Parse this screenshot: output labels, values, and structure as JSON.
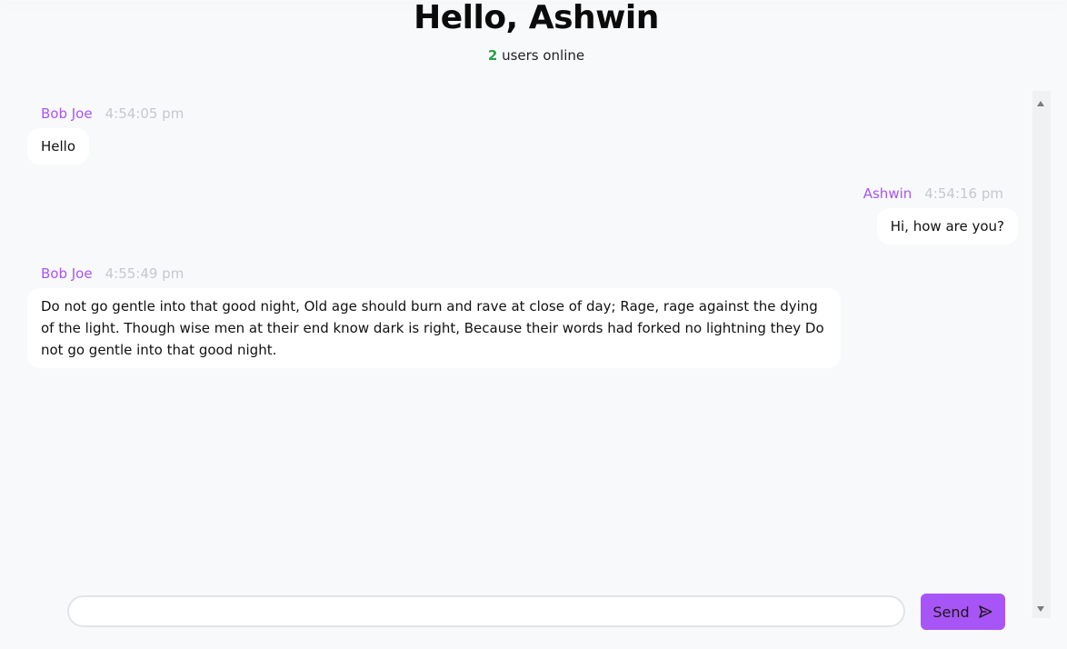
{
  "header": {
    "greeting": "Hello, Ashwin",
    "online_count": "2",
    "online_suffix": " users online"
  },
  "messages": [
    {
      "author": "Bob Joe",
      "time": "4:54:05 pm",
      "text": "Hello",
      "side": "left"
    },
    {
      "author": "Ashwin",
      "time": "4:54:16 pm",
      "text": "Hi, how are you?",
      "side": "right"
    },
    {
      "author": "Bob Joe",
      "time": "4:55:49 pm",
      "text": "Do not go gentle into that good night, Old age should burn and rave at close of day; Rage, rage against the dying of the light. Though wise men at their end know dark is right, Because their words had forked no lightning they Do not go gentle into that good night.",
      "side": "left"
    }
  ],
  "composer": {
    "input_value": "",
    "placeholder": "",
    "send_label": "Send",
    "send_icon": "send-icon"
  },
  "colors": {
    "accent": "#a855f7",
    "online": "#22a447",
    "background": "#f8f9fb",
    "timestamp": "#c6c8cc"
  }
}
